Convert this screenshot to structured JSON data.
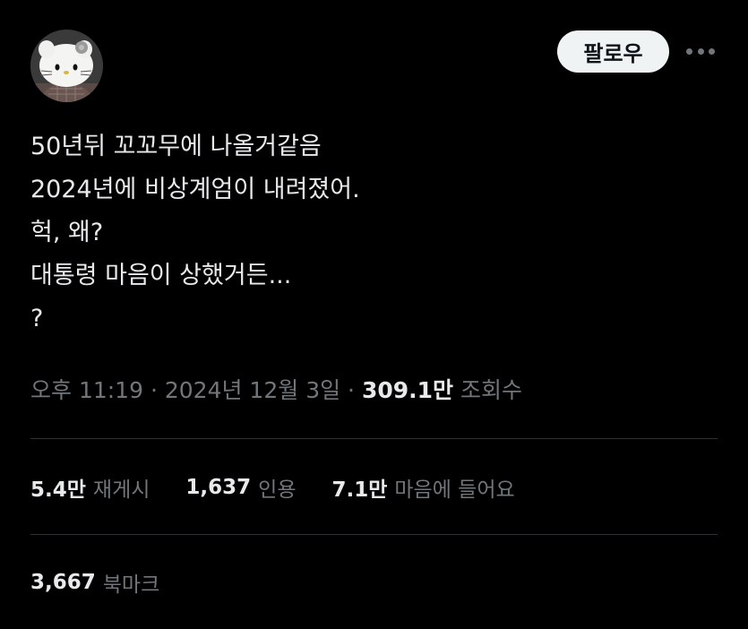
{
  "header": {
    "follow_label": "팔로우",
    "more_icon": "more-horizontal-icon"
  },
  "tweet": {
    "lines": [
      "50년뒤 꼬꼬무에 나올거같음",
      "2024년에 비상계엄이 내려졌어.",
      "헉, 왜?",
      "대통령 마음이 상했거든...",
      "?"
    ]
  },
  "meta": {
    "time": "오후 11:19",
    "separator": "·",
    "date": "2024년 12월 3일",
    "views_value": "309.1만",
    "views_label": "조회수"
  },
  "stats": {
    "reposts_value": "5.4만",
    "reposts_label": "재게시",
    "quotes_value": "1,637",
    "quotes_label": "인용",
    "likes_value": "7.1만",
    "likes_label": "마음에 들어요",
    "bookmarks_value": "3,667",
    "bookmarks_label": "북마크"
  },
  "colors": {
    "background": "#000000",
    "text_primary": "#e7e9ea",
    "text_secondary": "#71767b",
    "divider": "#2f3336",
    "follow_button_bg": "#eff3f4"
  }
}
